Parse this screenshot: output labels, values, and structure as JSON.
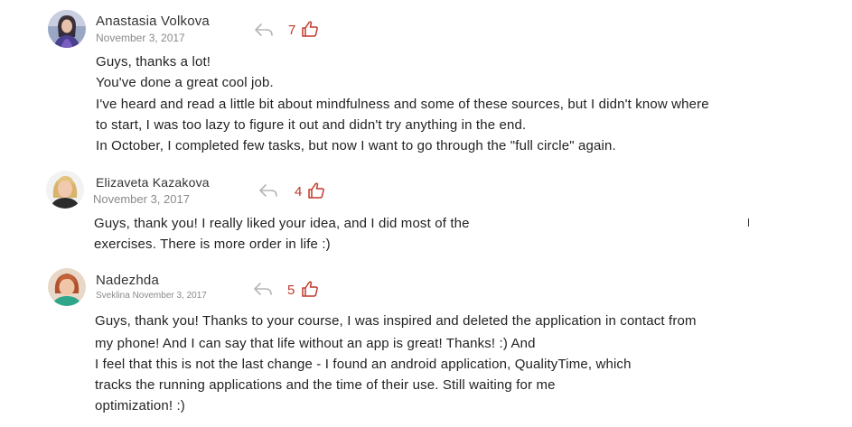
{
  "colors": {
    "text": "#222222",
    "date": "#8a8a8a",
    "like_count": "#c0392b",
    "icon": "#c0392b",
    "reply_icon": "#b5b5b5"
  },
  "icons": {
    "reply": "reply-arrow-icon",
    "like": "thumbs-up-icon"
  },
  "comments": [
    {
      "author": "Anastasia Volkova",
      "date": "November 3, 2017",
      "likes": "7",
      "lines": [
        "Guys, thanks a lot!",
        "You've done a great cool job.",
        "I've heard and read a little bit about mindfulness and some of these sources, but I didn't know where",
        "to start, I was too lazy to figure it out and didn't try anything in the end.",
        "In October, I completed few tasks, but now I want to go through the \"full circle\" again."
      ]
    },
    {
      "author": "Elizaveta Kazakova",
      "date": "November 3, 2017",
      "likes": "4",
      "lines": [
        "Guys, thank you! I really liked your idea, and I did most of the",
        "exercises. There is more order in life :)"
      ]
    },
    {
      "author": "Nadezhda",
      "date": "Sveklina November 3, 2017",
      "likes": "5",
      "lines": [
        "Guys, thank you! Thanks to your course, I was inspired and deleted the application in contact from",
        "my phone! And I can say that life without an app is great! Thanks! :) And",
        "I feel that this is not the last change - I found an android application, QualityTime, which",
        "tracks the running applications and the time of their use. Still waiting for me",
        "optimization! :)"
      ]
    }
  ]
}
